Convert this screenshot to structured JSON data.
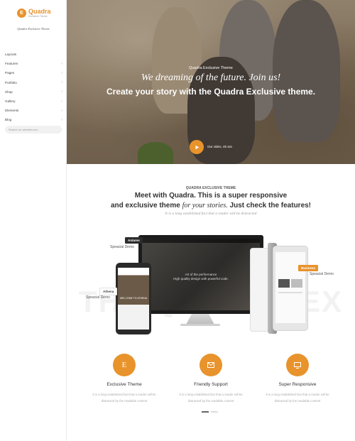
{
  "logo": {
    "mark": "E",
    "name": "Quadra",
    "sub": "Exclusive Theme"
  },
  "sidebar": {
    "tagline": "Quadra Exclusive Theme",
    "items": [
      {
        "label": "Layouts",
        "chevron": false
      },
      {
        "label": "Features",
        "chevron": true
      },
      {
        "label": "Pages",
        "chevron": true
      },
      {
        "label": "Portfolio",
        "chevron": true
      },
      {
        "label": "Shop",
        "chevron": true
      },
      {
        "label": "Gallery",
        "chevron": true
      },
      {
        "label": "Elements",
        "chevron": true
      },
      {
        "label": "Blog",
        "chevron": true
      }
    ],
    "search_placeholder": "Search on website.com"
  },
  "hero": {
    "kicker": "Quadra Exclusive Theme",
    "script": "We dreaming of the future. Join us!",
    "title": "Create your story with the Quadra Exclusive theme.",
    "video_label": "Our video, 45 sec"
  },
  "section": {
    "kicker": "QUADRA EXCLUSIVE THEME",
    "head1": "Meet with Quadra. This is a super responsive",
    "head2_a": "and exclusive theme ",
    "head2_serif": "for your stories.",
    "head2_b": " Just check the features!",
    "lead": "It is a long established fact that a reader will be distracted",
    "watermark": "THE QUADRA EX"
  },
  "showcase": {
    "callout_antares": "Antares",
    "callout_antares_sub": "Speacial Demo",
    "callout_athena": "Athena",
    "callout_athena_sub": "Speacial Demo",
    "callout_business": "Business",
    "callout_business_sub": "Speacial Demo",
    "monitor_line1": "Art of the performance",
    "monitor_line2": "High quality design with powerful code.",
    "phone_line": "WELCOME TO ATHENA"
  },
  "features": [
    {
      "icon": "E",
      "title": "Exclusive Theme",
      "desc": "It is a long established fact that a reader will be distracted by the readable content"
    },
    {
      "icon": "mail-icon",
      "title": "Friendly Support",
      "desc": "It is a long established fact that a reader will be distracted by the readable content"
    },
    {
      "icon": "monitor-icon",
      "title": "Super Responsive",
      "desc": "It is a long established fact that a reader will be distracted by the readable content"
    }
  ],
  "pager": {
    "count": 2,
    "active": 0
  },
  "colors": {
    "accent": "#e8932c"
  }
}
